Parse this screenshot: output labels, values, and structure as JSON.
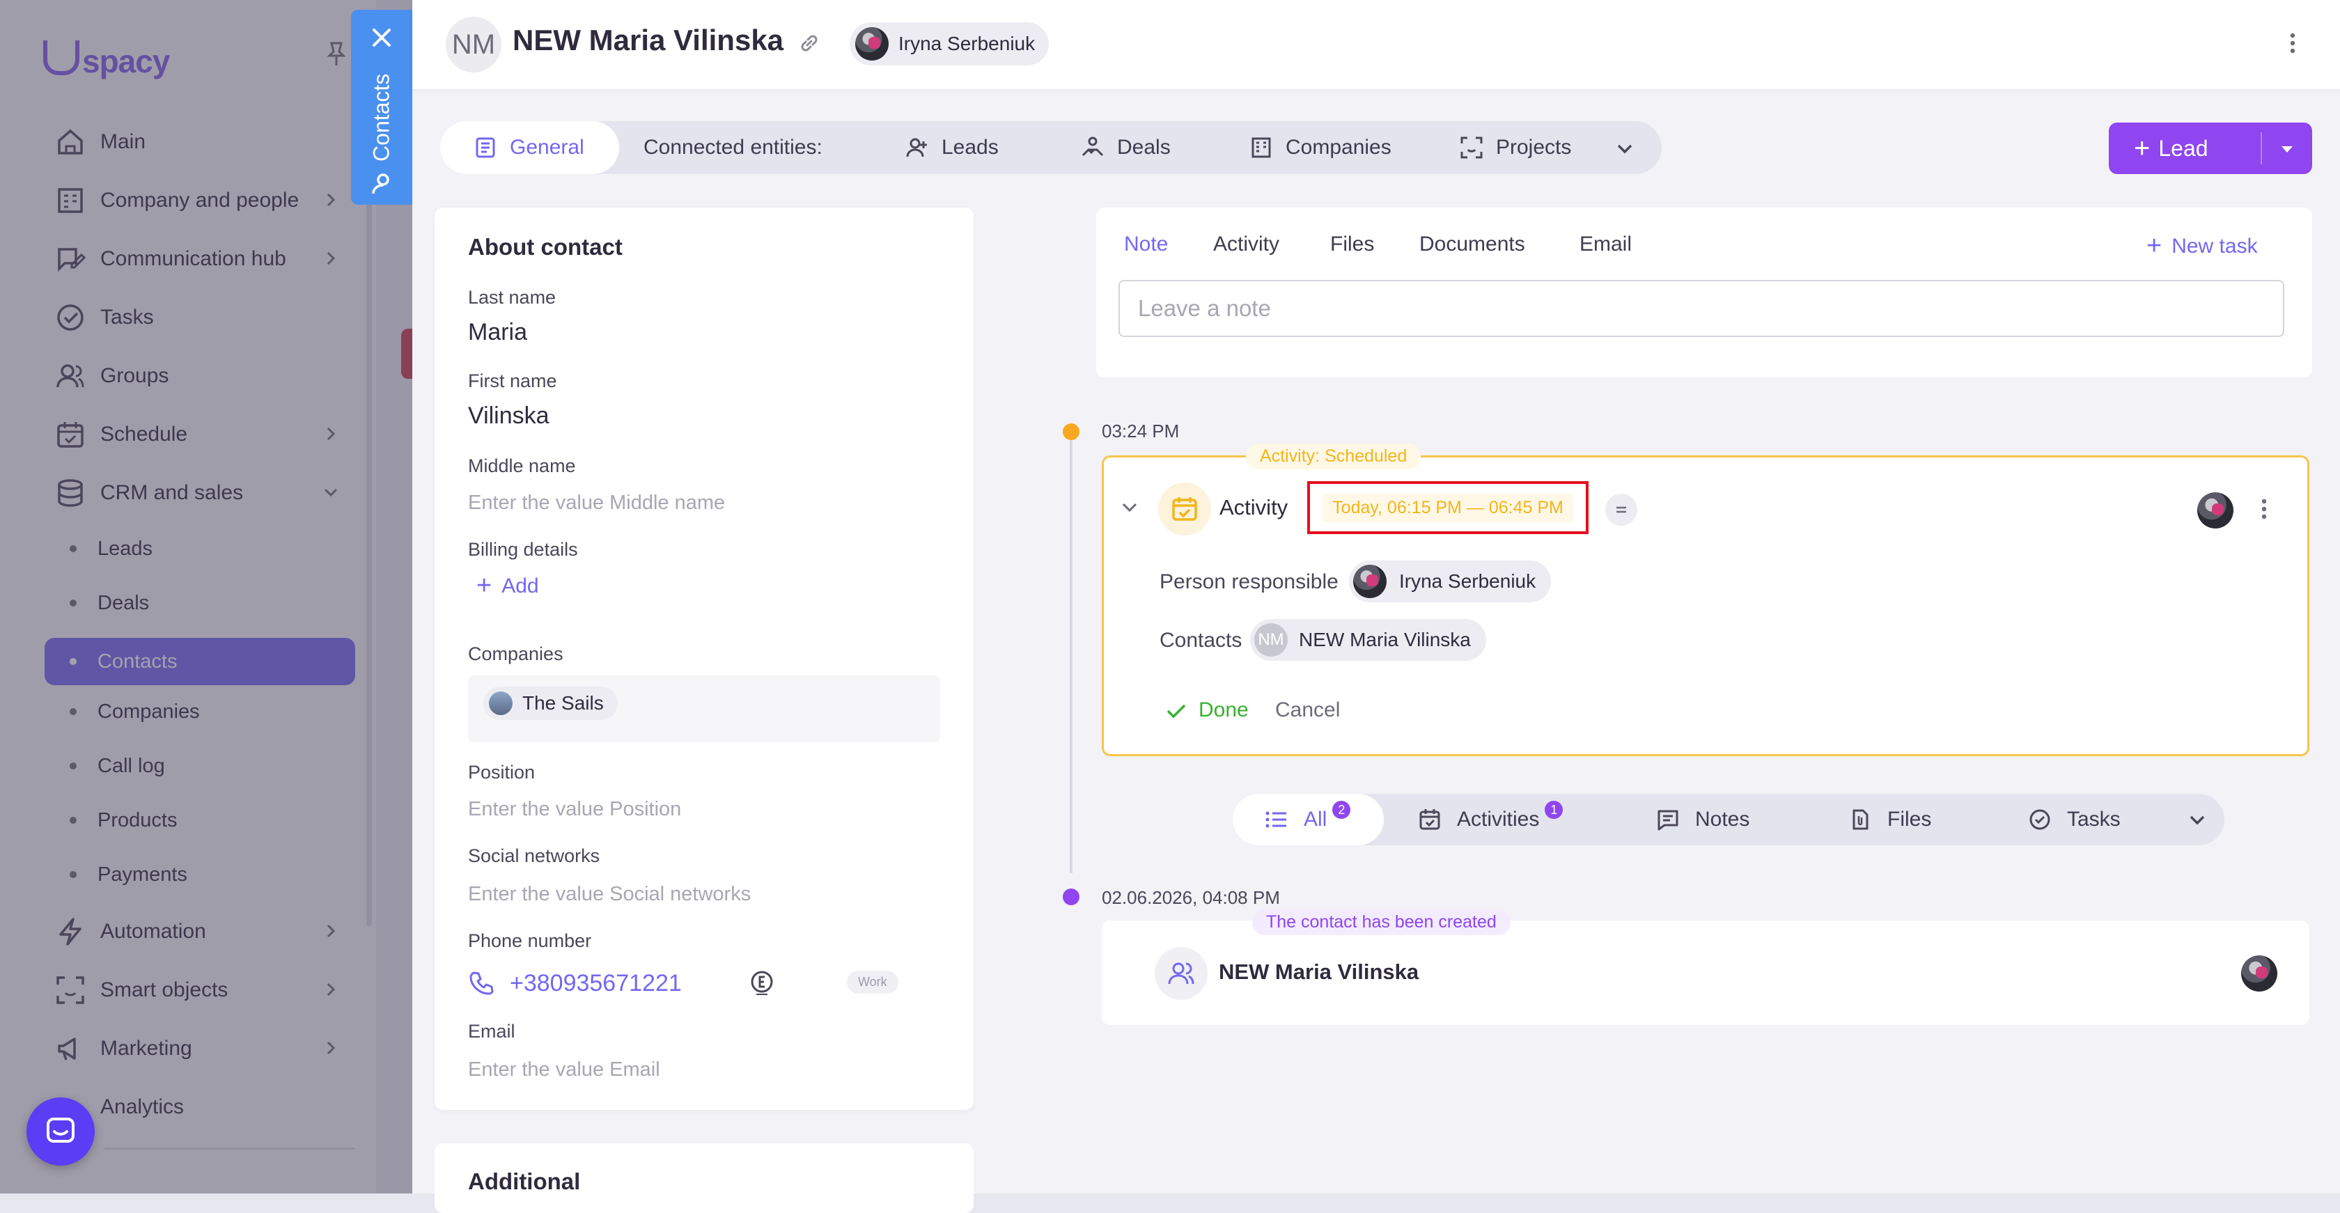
{
  "sidebar": {
    "logo": "spacy",
    "items": [
      {
        "label": "Main",
        "icon": "home-icon"
      },
      {
        "label": "Company and people",
        "icon": "building-icon"
      },
      {
        "label": "Communication hub",
        "icon": "chat-edit-icon"
      },
      {
        "label": "Tasks",
        "icon": "check-circle-icon"
      },
      {
        "label": "Groups",
        "icon": "users-icon"
      },
      {
        "label": "Schedule",
        "icon": "calendar-icon"
      },
      {
        "label": "CRM and sales",
        "icon": "database-icon"
      },
      {
        "label": "Automation",
        "icon": "lightning-icon"
      },
      {
        "label": "Smart objects",
        "icon": "scan-face-icon"
      },
      {
        "label": "Marketing",
        "icon": "megaphone-icon"
      },
      {
        "label": "Analytics",
        "icon": "chart-icon"
      }
    ],
    "crm_subitems": [
      "Leads",
      "Deals",
      "Contacts",
      "Companies",
      "Call log",
      "Products",
      "Payments"
    ],
    "active_subitem": "Contacts"
  },
  "drawer_tab": {
    "label": "Contacts"
  },
  "header": {
    "avatar_initials": "NM",
    "title": "NEW Maria Vilinska",
    "user_chip": "Iryna Serbeniuk"
  },
  "entity_tabs": {
    "general": "General",
    "connected": "Connected entities:",
    "leads": "Leads",
    "deals": "Deals",
    "companies": "Companies",
    "projects": "Projects"
  },
  "lead_button": {
    "label": "Lead"
  },
  "about": {
    "title": "About contact",
    "last_name_label": "Last name",
    "last_name": "Maria",
    "first_name_label": "First name",
    "first_name": "Vilinska",
    "middle_name_label": "Middle name",
    "middle_name_placeholder": "Enter the value Middle name",
    "billing_label": "Billing details",
    "billing_add": "Add",
    "companies_label": "Companies",
    "company": "The Sails",
    "position_label": "Position",
    "position_placeholder": "Enter the value Position",
    "social_label": "Social networks",
    "social_placeholder": "Enter the value Social networks",
    "phone_label": "Phone number",
    "phone": "+380935671221",
    "phone_type": "Work",
    "email_label": "Email",
    "email_placeholder": "Enter the value Email"
  },
  "additional": {
    "title": "Additional"
  },
  "note_composer": {
    "tabs": [
      "Note",
      "Activity",
      "Files",
      "Documents",
      "Email"
    ],
    "active_tab": "Note",
    "new_task": "New task",
    "placeholder": "Leave a note"
  },
  "timeline": {
    "activity_time": "03:24 PM",
    "activity_tag": "Activity: Scheduled",
    "activity_title": "Activity",
    "activity_schedule": "Today, 06:15 PM — 06:45 PM",
    "person_responsible_label": "Person responsible",
    "person_responsible": "Iryna Serbeniuk",
    "contacts_label": "Contacts",
    "contact_initials": "NM",
    "contact_name": "NEW Maria Vilinska",
    "done": "Done",
    "cancel": "Cancel",
    "created_time": "02.06.2026, 04:08 PM",
    "created_tag": "The contact has been created",
    "created_title": "NEW Maria Vilinska"
  },
  "filters": {
    "all": "All",
    "all_count": "2",
    "activities": "Activities",
    "activities_count": "1",
    "notes": "Notes",
    "files": "Files",
    "tasks": "Tasks"
  },
  "colors": {
    "accent": "#7367f0",
    "lead_button": "#8f45ef",
    "scheduled": "#f2b51c",
    "highlight_box": "#e5101d",
    "done": "#38b12e",
    "drawer_tab": "#4a90ee"
  }
}
